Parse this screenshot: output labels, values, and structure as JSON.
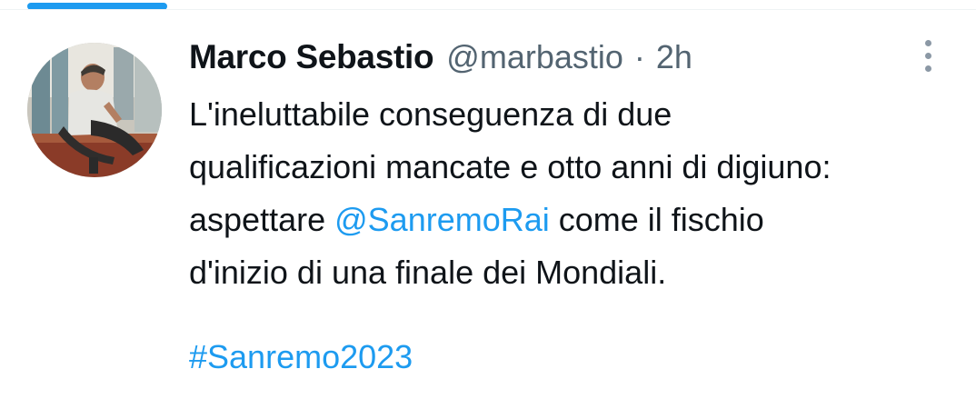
{
  "colors": {
    "accent": "#1d9bf0",
    "text_primary": "#0f1419",
    "text_secondary": "#536471",
    "divider": "#eff3f4"
  },
  "tweet": {
    "author": {
      "display_name": "Marco Sebastio",
      "handle": "@marbastio",
      "avatar_icon": "user-photo"
    },
    "separator": "·",
    "time": "2h",
    "more_icon": "more-vertical-icon",
    "text": {
      "line1": "L'ineluttabile conseguenza di due",
      "line2": "qualificazioni mancate e otto anni di digiuno:",
      "line3_before": "aspettare ",
      "mention": "@SanremoRai",
      "line3_after": " come il fischio",
      "line4": "d'inizio di una finale dei Mondiali."
    },
    "hashtag": "#Sanremo2023"
  }
}
